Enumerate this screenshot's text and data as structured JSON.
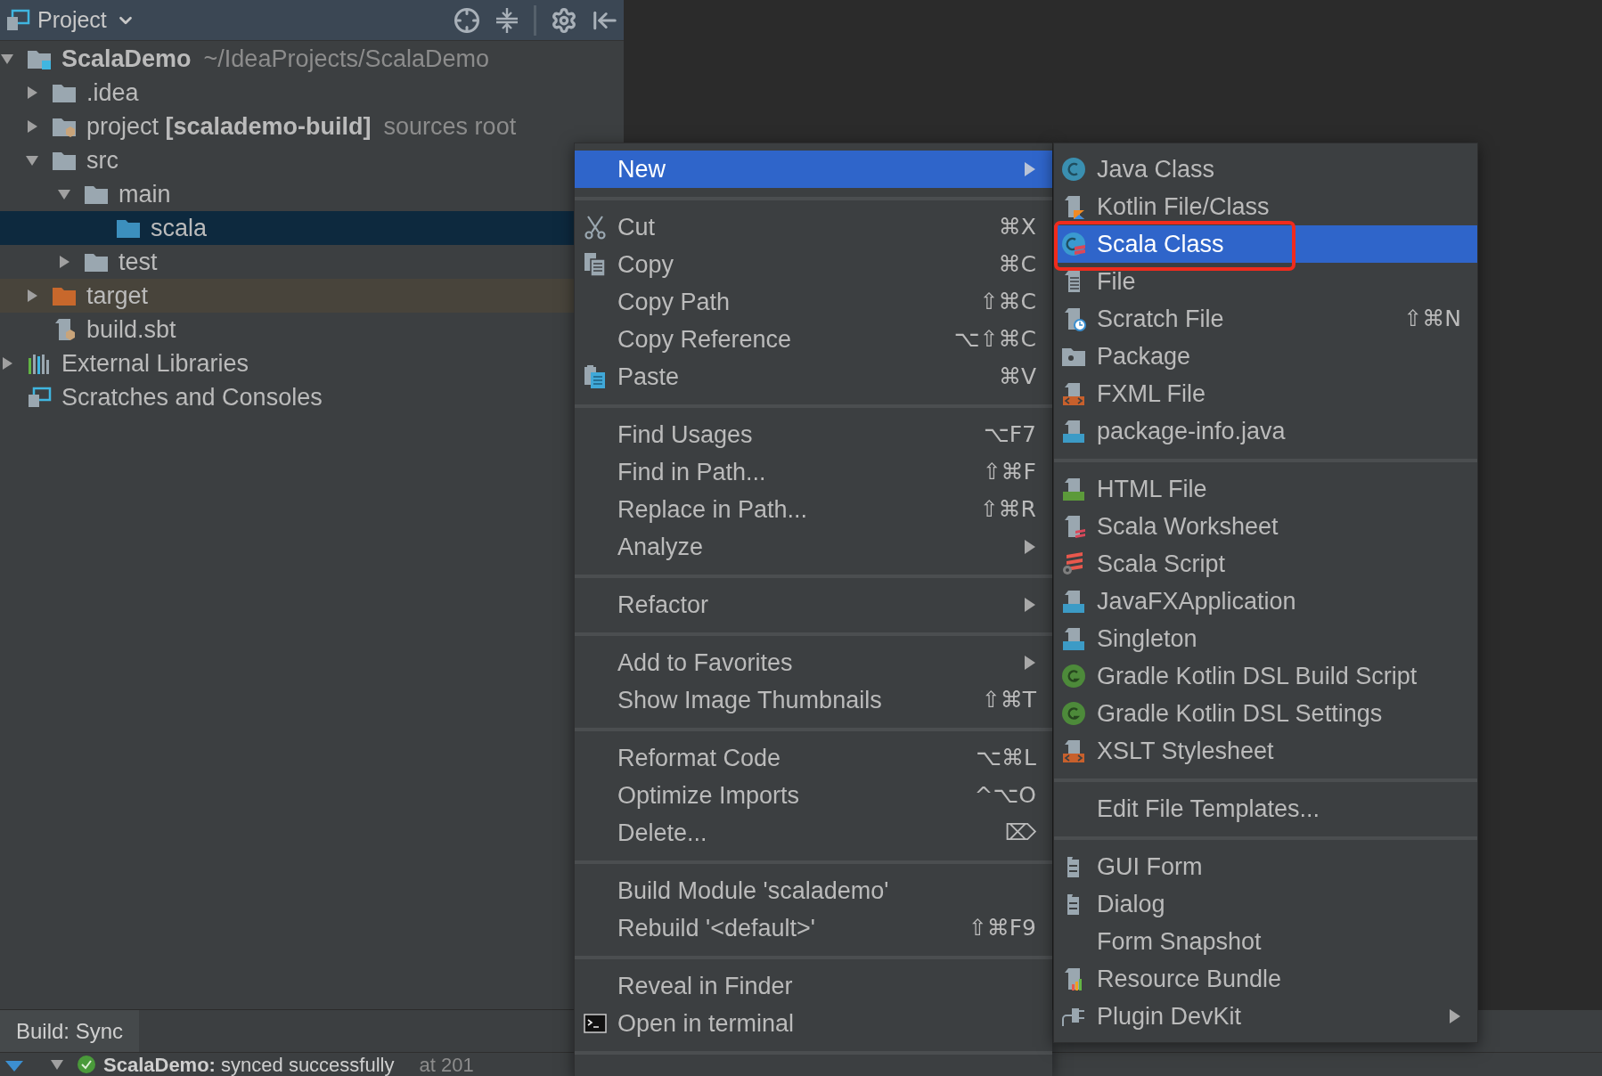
{
  "project_panel": {
    "title": "Project",
    "tree": [
      {
        "label": "ScalaDemo",
        "hint": "~/IdeaProjects/ScalaDemo",
        "kind": "module",
        "expanded": true,
        "selected": false,
        "children": [
          {
            "label": ".idea",
            "kind": "folder",
            "expanded": false,
            "selected": false
          },
          {
            "label": "project **[scalademo-build]**",
            "hint": "sources root",
            "kind": "sbt-folder",
            "expanded": false,
            "selected": false
          },
          {
            "label": "src",
            "kind": "folder",
            "expanded": true,
            "selected": false,
            "children": [
              {
                "label": "main",
                "kind": "folder",
                "expanded": true,
                "selected": false,
                "children": [
                  {
                    "label": "scala",
                    "kind": "source-root",
                    "selected": true
                  }
                ]
              },
              {
                "label": "test",
                "kind": "folder",
                "expanded": false,
                "selected": false
              }
            ]
          },
          {
            "label": "target",
            "kind": "excluded-folder",
            "expanded": false,
            "selected": false
          },
          {
            "label": "build.sbt",
            "kind": "sbt-file",
            "selected": false
          }
        ]
      },
      {
        "label": "External Libraries",
        "kind": "libraries",
        "expanded": false,
        "selected": false
      },
      {
        "label": "Scratches and Consoles",
        "kind": "scratches",
        "selected": false
      }
    ]
  },
  "context_menu": {
    "groups": [
      [
        {
          "label": "New",
          "submenu": true,
          "selected": true
        }
      ],
      [
        {
          "label": "Cut",
          "kind": "cut",
          "shortcut": "⌘X",
          "submenu": false,
          "selected": false
        },
        {
          "label": "Copy",
          "kind": "copy",
          "shortcut": "⌘C",
          "submenu": false,
          "selected": false
        },
        {
          "label": "Copy Path",
          "shortcut": "⇧⌘C",
          "submenu": false,
          "selected": false
        },
        {
          "label": "Copy Reference",
          "shortcut": "⌥⇧⌘C",
          "submenu": false,
          "selected": false
        },
        {
          "label": "Paste",
          "kind": "paste",
          "shortcut": "⌘V",
          "submenu": false,
          "selected": false
        }
      ],
      [
        {
          "label": "Find Usages",
          "shortcut": "⌥F7",
          "submenu": false,
          "selected": false
        },
        {
          "label": "Find in Path...",
          "shortcut": "⇧⌘F",
          "submenu": false,
          "selected": false
        },
        {
          "label": "Replace in Path...",
          "shortcut": "⇧⌘R",
          "submenu": false,
          "selected": false
        },
        {
          "label": "Analyze",
          "submenu": true,
          "selected": false
        }
      ],
      [
        {
          "label": "Refactor",
          "submenu": true,
          "selected": false
        }
      ],
      [
        {
          "label": "Add to Favorites",
          "submenu": true,
          "selected": false
        },
        {
          "label": "Show Image Thumbnails",
          "shortcut": "⇧⌘T",
          "submenu": false,
          "selected": false
        }
      ],
      [
        {
          "label": "Reformat Code",
          "shortcut": "⌥⌘L",
          "submenu": false,
          "selected": false
        },
        {
          "label": "Optimize Imports",
          "shortcut": "^⌥O",
          "submenu": false,
          "selected": false
        },
        {
          "label": "Delete...",
          "shortcut": "⌦",
          "submenu": false,
          "selected": false
        }
      ],
      [
        {
          "label": "Build Module 'scalademo'",
          "submenu": false,
          "selected": false
        },
        {
          "label": "Rebuild '<default>'",
          "shortcut": "⇧⌘F9",
          "submenu": false,
          "selected": false
        }
      ],
      [
        {
          "label": "Reveal in Finder",
          "submenu": false,
          "selected": false
        },
        {
          "label": "Open in terminal",
          "kind": "terminal",
          "submenu": false,
          "selected": false
        }
      ]
    ]
  },
  "new_submenu": {
    "framed_selection": true,
    "groups": [
      [
        {
          "label": "Java Class",
          "kind": "java-class",
          "submenu": false,
          "selected": false
        },
        {
          "label": "Kotlin File/Class",
          "kind": "kotlin-file",
          "submenu": false,
          "selected": false
        },
        {
          "label": "Scala Class",
          "kind": "scala-class",
          "submenu": false,
          "selected": true
        },
        {
          "label": "File",
          "kind": "text-file",
          "submenu": false,
          "selected": false
        },
        {
          "label": "Scratch File",
          "kind": "scratch-file",
          "shortcut": "⇧⌘N",
          "submenu": false,
          "selected": false
        },
        {
          "label": "Package",
          "kind": "package",
          "submenu": false,
          "selected": false
        },
        {
          "label": "FXML File",
          "kind": "xml-file",
          "submenu": false,
          "selected": false
        },
        {
          "label": "package-info.java",
          "kind": "java-file",
          "submenu": false,
          "selected": false
        }
      ],
      [
        {
          "label": "HTML File",
          "kind": "html-file",
          "submenu": false,
          "selected": false
        },
        {
          "label": "Scala Worksheet",
          "kind": "scala-worksheet",
          "submenu": false,
          "selected": false
        },
        {
          "label": "Scala Script",
          "kind": "scala-script",
          "submenu": false,
          "selected": false
        },
        {
          "label": "JavaFXApplication",
          "kind": "java-file",
          "submenu": false,
          "selected": false
        },
        {
          "label": "Singleton",
          "kind": "java-file",
          "submenu": false,
          "selected": false
        },
        {
          "label": "Gradle Kotlin DSL Build Script",
          "kind": "gradle",
          "submenu": false,
          "selected": false
        },
        {
          "label": "Gradle Kotlin DSL Settings",
          "kind": "gradle",
          "submenu": false,
          "selected": false
        },
        {
          "label": "XSLT Stylesheet",
          "kind": "xml-file",
          "submenu": false,
          "selected": false
        }
      ],
      [
        {
          "label": "Edit File Templates...",
          "submenu": false,
          "selected": false
        }
      ],
      [
        {
          "label": "GUI Form",
          "kind": "form",
          "submenu": false,
          "selected": false
        },
        {
          "label": "Dialog",
          "kind": "form",
          "submenu": false,
          "selected": false
        },
        {
          "label": "Form Snapshot",
          "submenu": false,
          "selected": false
        },
        {
          "label": "Resource Bundle",
          "kind": "bundle",
          "submenu": false,
          "selected": false
        },
        {
          "label": "Plugin DevKit",
          "kind": "plugin",
          "submenu": true,
          "selected": false
        }
      ]
    ]
  },
  "build_panel": {
    "tabs": [
      {
        "label": "Build: Sync",
        "selected": true
      }
    ],
    "rows": [
      {
        "message": "**ScalaDemo:** synced successfully",
        "time": "at 201"
      }
    ]
  }
}
